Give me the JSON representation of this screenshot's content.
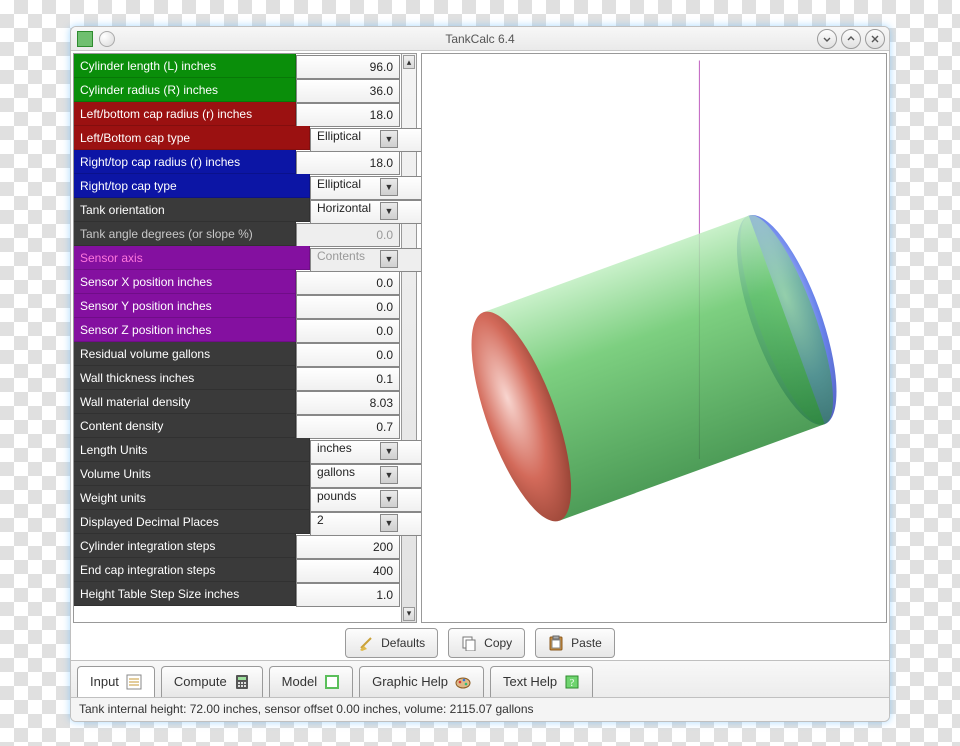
{
  "window": {
    "title": "TankCalc 6.4"
  },
  "params": [
    {
      "id": "cyl-length",
      "label": "Cylinder length (L) inches",
      "value": "96.0",
      "type": "num",
      "bg": "bg-green",
      "txt": ""
    },
    {
      "id": "cyl-radius",
      "label": "Cylinder radius (R) inches",
      "value": "36.0",
      "type": "num",
      "bg": "bg-green",
      "txt": ""
    },
    {
      "id": "lcap-radius",
      "label": "Left/bottom cap radius (r) inches",
      "value": "18.0",
      "type": "num",
      "bg": "bg-red",
      "txt": ""
    },
    {
      "id": "lcap-type",
      "label": "Left/Bottom cap type",
      "value": "Elliptical",
      "type": "sel",
      "bg": "bg-red",
      "txt": ""
    },
    {
      "id": "rcap-radius",
      "label": "Right/top cap radius (r) inches",
      "value": "18.0",
      "type": "num",
      "bg": "bg-blue",
      "txt": ""
    },
    {
      "id": "rcap-type",
      "label": "Right/top cap type",
      "value": "Elliptical",
      "type": "sel",
      "bg": "bg-blue",
      "txt": ""
    },
    {
      "id": "orientation",
      "label": "Tank orientation",
      "value": "Horizontal",
      "type": "sel",
      "bg": "bg-dark",
      "txt": ""
    },
    {
      "id": "angle",
      "label": "Tank angle degrees (or slope %)",
      "value": "0.0",
      "type": "numdis",
      "bg": "bg-dark",
      "txt": "txt-dim"
    },
    {
      "id": "sensor-axis",
      "label": "Sensor axis",
      "value": "Contents",
      "type": "seldis",
      "bg": "bg-purple",
      "txt": "txt-pink"
    },
    {
      "id": "sensor-x",
      "label": "Sensor X position inches",
      "value": "0.0",
      "type": "num",
      "bg": "bg-purple",
      "txt": ""
    },
    {
      "id": "sensor-y",
      "label": "Sensor Y position inches",
      "value": "0.0",
      "type": "num",
      "bg": "bg-purple",
      "txt": ""
    },
    {
      "id": "sensor-z",
      "label": "Sensor Z position inches",
      "value": "0.0",
      "type": "num",
      "bg": "bg-purple",
      "txt": ""
    },
    {
      "id": "resid-vol",
      "label": "Residual volume gallons",
      "value": "0.0",
      "type": "num",
      "bg": "bg-dark",
      "txt": ""
    },
    {
      "id": "wall-thick",
      "label": "Wall thickness inches",
      "value": "0.1",
      "type": "num",
      "bg": "bg-dark",
      "txt": ""
    },
    {
      "id": "wall-density",
      "label": "Wall material density",
      "value": "8.03",
      "type": "num",
      "bg": "bg-dark",
      "txt": ""
    },
    {
      "id": "cont-density",
      "label": "Content density",
      "value": "0.7",
      "type": "num",
      "bg": "bg-dark",
      "txt": ""
    },
    {
      "id": "length-units",
      "label": "Length Units",
      "value": "inches",
      "type": "sel",
      "bg": "bg-dark",
      "txt": ""
    },
    {
      "id": "volume-units",
      "label": "Volume Units",
      "value": "gallons",
      "type": "sel",
      "bg": "bg-dark",
      "txt": ""
    },
    {
      "id": "weight-units",
      "label": "Weight units",
      "value": "pounds",
      "type": "sel",
      "bg": "bg-dark",
      "txt": ""
    },
    {
      "id": "dec-places",
      "label": "Displayed Decimal Places",
      "value": "2",
      "type": "sel",
      "bg": "bg-dark",
      "txt": ""
    },
    {
      "id": "cyl-steps",
      "label": "Cylinder integration steps",
      "value": "200",
      "type": "num",
      "bg": "bg-dark",
      "txt": ""
    },
    {
      "id": "cap-steps",
      "label": "End cap integration steps",
      "value": "400",
      "type": "num",
      "bg": "bg-dark",
      "txt": ""
    },
    {
      "id": "ht-step",
      "label": "Height Table Step Size inches",
      "value": "1.0",
      "type": "num",
      "bg": "bg-dark",
      "txt": ""
    }
  ],
  "toolbar": {
    "defaults": "Defaults",
    "copy": "Copy",
    "paste": "Paste"
  },
  "tabs": {
    "input": "Input",
    "compute": "Compute",
    "model": "Model",
    "ghelp": "Graphic Help",
    "thelp": "Text Help"
  },
  "status": "Tank internal height: 72.00 inches, sensor offset 0.00 inches, volume: 2115.07 gallons"
}
